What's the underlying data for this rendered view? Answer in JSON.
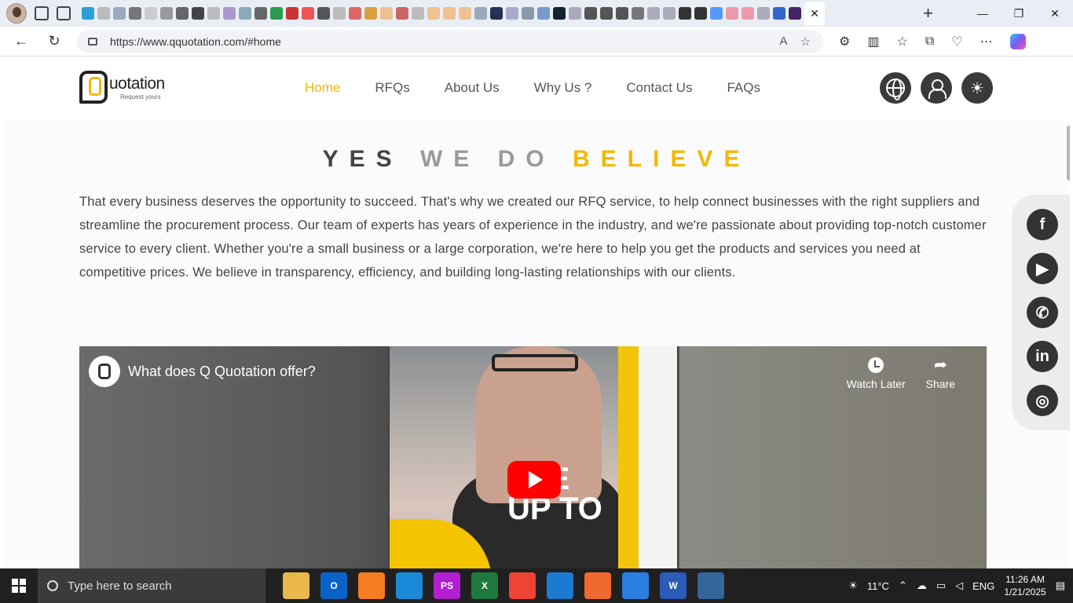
{
  "browser": {
    "url": "https://www.qquotation.com/#home",
    "active_tab_close": "✕",
    "new_tab": "+"
  },
  "site": {
    "logo": {
      "word": "uotation",
      "tagline": "Request yours"
    },
    "menu": [
      "Home",
      "RFQs",
      "About Us",
      "Why Us ?",
      "Contact Us",
      "FAQs"
    ],
    "active_menu": "Home",
    "heading": {
      "part1": "YES",
      "part2": "WE DO",
      "part3": "BELIEVE"
    },
    "paragraph": "That every business deserves the opportunity to succeed. That's why we created our RFQ service, to help connect businesses with the right suppliers and streamline the procurement process. Our team of experts has years of experience in the industry, and we're passionate about providing top-notch customer service to every client. Whether you're a small business or a large corporation, we're here to help you get the products and services you need at competitive prices. We believe in transparency, efficiency, and building long-lasting relationships with our clients.",
    "video": {
      "title": "What does Q Quotation offer?",
      "watch_later": "Watch Later",
      "share": "Share",
      "overlay_text": "AVE\nUP TO"
    },
    "social": [
      "facebook-icon",
      "youtube-icon",
      "whatsapp-icon",
      "linkedin-icon",
      "instagram-icon"
    ],
    "colors": {
      "accent": "#f5b800",
      "dark": "#3a3a3a"
    }
  },
  "taskbar": {
    "search_placeholder": "Type here to search",
    "weather": "11°C",
    "language": "ENG",
    "time": "11:26 AM",
    "date": "1/21/2025"
  }
}
